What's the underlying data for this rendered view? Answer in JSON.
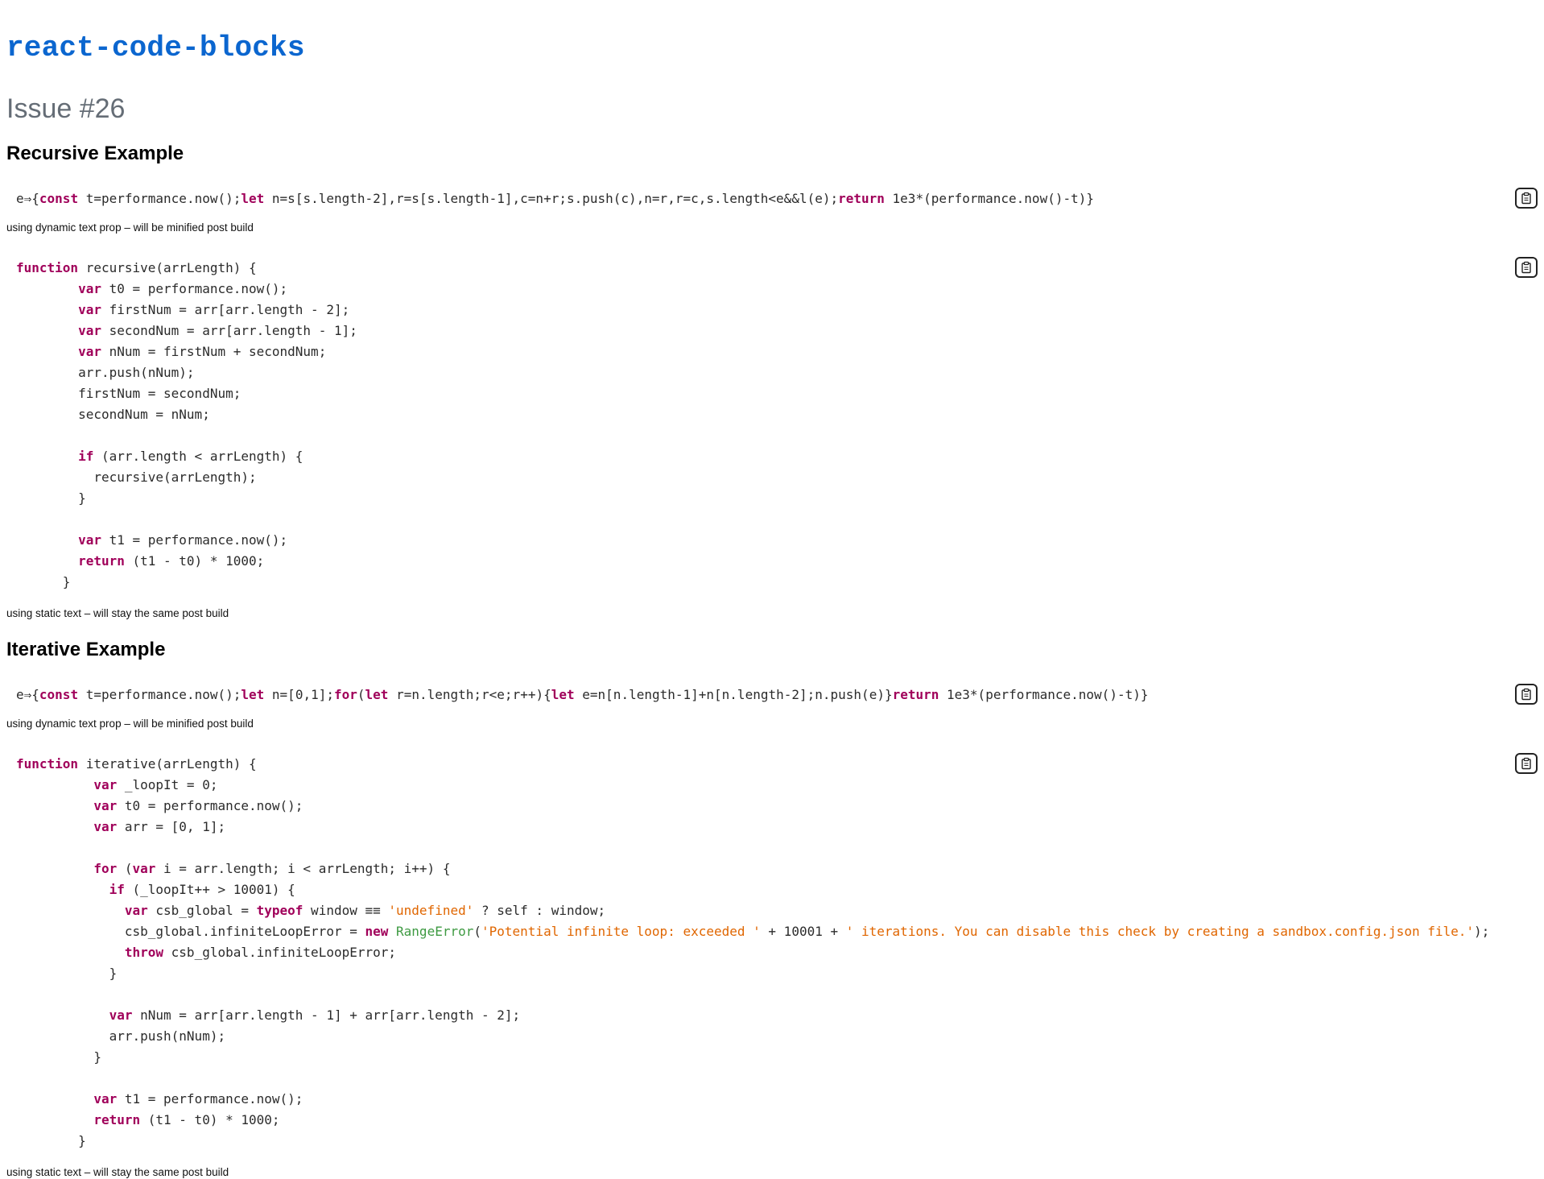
{
  "header": {
    "title": "react-code-blocks",
    "issue": "Issue #26"
  },
  "icons": {
    "copy": "clipboard-icon"
  },
  "sections": {
    "recursive": {
      "title": "Recursive Example",
      "dynamic_caption": "using dynamic text prop – will be minified post build",
      "static_caption": "using static text – will stay the same post build"
    },
    "iterative": {
      "title": "Iterative Example",
      "dynamic_caption": "using dynamic text prop – will be minified post build",
      "static_caption": "using static text – will stay the same post build"
    }
  },
  "code_blocks": {
    "recursive_minified": [
      [
        [
          "p",
          "e⇒{"
        ],
        [
          "k",
          "const"
        ],
        [
          "p",
          " t=performance.now();"
        ],
        [
          "k",
          "let"
        ],
        [
          "p",
          " n=s[s.length-2],r=s[s.length-1],c=n+r;s.push(c),n=r,r=c,s.length<e&&l(e);"
        ],
        [
          "k",
          "return"
        ],
        [
          "p",
          " 1e3*(performance.now()-t)}"
        ]
      ]
    ],
    "recursive_static": [
      [
        [
          "k",
          "function"
        ],
        [
          "p",
          " recursive(arrLength) {"
        ]
      ],
      [
        [
          "p",
          "        "
        ],
        [
          "k",
          "var"
        ],
        [
          "p",
          " t0 = performance.now();"
        ]
      ],
      [
        [
          "p",
          "        "
        ],
        [
          "k",
          "var"
        ],
        [
          "p",
          " firstNum = arr[arr.length - 2];"
        ]
      ],
      [
        [
          "p",
          "        "
        ],
        [
          "k",
          "var"
        ],
        [
          "p",
          " secondNum = arr[arr.length - 1];"
        ]
      ],
      [
        [
          "p",
          "        "
        ],
        [
          "k",
          "var"
        ],
        [
          "p",
          " nNum = firstNum + secondNum;"
        ]
      ],
      [
        [
          "p",
          "        arr.push(nNum);"
        ]
      ],
      [
        [
          "p",
          "        firstNum = secondNum;"
        ]
      ],
      [
        [
          "p",
          "        secondNum = nNum;"
        ]
      ],
      [
        [
          "p",
          ""
        ]
      ],
      [
        [
          "p",
          "        "
        ],
        [
          "k",
          "if"
        ],
        [
          "p",
          " (arr.length < arrLength) {"
        ]
      ],
      [
        [
          "p",
          "          recursive(arrLength);"
        ]
      ],
      [
        [
          "p",
          "        }"
        ]
      ],
      [
        [
          "p",
          ""
        ]
      ],
      [
        [
          "p",
          "        "
        ],
        [
          "k",
          "var"
        ],
        [
          "p",
          " t1 = performance.now();"
        ]
      ],
      [
        [
          "p",
          "        "
        ],
        [
          "k",
          "return"
        ],
        [
          "p",
          " (t1 - t0) * 1000;"
        ]
      ],
      [
        [
          "p",
          "      }"
        ]
      ]
    ],
    "iterative_minified": [
      [
        [
          "p",
          "e⇒{"
        ],
        [
          "k",
          "const"
        ],
        [
          "p",
          " t=performance.now();"
        ],
        [
          "k",
          "let"
        ],
        [
          "p",
          " n=[0,1];"
        ],
        [
          "k",
          "for"
        ],
        [
          "p",
          "("
        ],
        [
          "k",
          "let"
        ],
        [
          "p",
          " r=n.length;r<e;r++){"
        ],
        [
          "k",
          "let"
        ],
        [
          "p",
          " e=n[n.length-1]+n[n.length-2];n.push(e)}"
        ],
        [
          "k",
          "return"
        ],
        [
          "p",
          " 1e3*(performance.now()-t)}"
        ]
      ]
    ],
    "iterative_static": [
      [
        [
          "k",
          "function"
        ],
        [
          "p",
          " iterative(arrLength) {"
        ]
      ],
      [
        [
          "p",
          "          "
        ],
        [
          "k",
          "var"
        ],
        [
          "p",
          " _loopIt = 0;"
        ]
      ],
      [
        [
          "p",
          "          "
        ],
        [
          "k",
          "var"
        ],
        [
          "p",
          " t0 = performance.now();"
        ]
      ],
      [
        [
          "p",
          "          "
        ],
        [
          "k",
          "var"
        ],
        [
          "p",
          " arr = [0, 1];"
        ]
      ],
      [
        [
          "p",
          ""
        ]
      ],
      [
        [
          "p",
          "          "
        ],
        [
          "k",
          "for"
        ],
        [
          "p",
          " ("
        ],
        [
          "k",
          "var"
        ],
        [
          "p",
          " i = arr.length; i < arrLength; i++) {"
        ]
      ],
      [
        [
          "p",
          "            "
        ],
        [
          "k",
          "if"
        ],
        [
          "p",
          " (_loopIt++ > 10001) {"
        ]
      ],
      [
        [
          "p",
          "              "
        ],
        [
          "k",
          "var"
        ],
        [
          "p",
          " csb_global = "
        ],
        [
          "k",
          "typeof"
        ],
        [
          "p",
          " window ≡≡ "
        ],
        [
          "s",
          "'undefined'"
        ],
        [
          "p",
          " ? self : window;"
        ]
      ],
      [
        [
          "p",
          "              csb_global.infiniteLoopError = "
        ],
        [
          "k",
          "new"
        ],
        [
          "p",
          " "
        ],
        [
          "c",
          "RangeError"
        ],
        [
          "p",
          "("
        ],
        [
          "s",
          "'Potential infinite loop: exceeded '"
        ],
        [
          "p",
          " + 10001 + "
        ],
        [
          "s",
          "' iterations. You can disable this check by creating a sandbox.config.json file.'"
        ],
        [
          "p",
          ");"
        ]
      ],
      [
        [
          "p",
          "              "
        ],
        [
          "k",
          "throw"
        ],
        [
          "p",
          " csb_global.infiniteLoopError;"
        ]
      ],
      [
        [
          "p",
          "            }"
        ]
      ],
      [
        [
          "p",
          ""
        ]
      ],
      [
        [
          "p",
          "            "
        ],
        [
          "k",
          "var"
        ],
        [
          "p",
          " nNum = arr[arr.length - 1] + arr[arr.length - 2];"
        ]
      ],
      [
        [
          "p",
          "            arr.push(nNum);"
        ]
      ],
      [
        [
          "p",
          "          }"
        ]
      ],
      [
        [
          "p",
          ""
        ]
      ],
      [
        [
          "p",
          "          "
        ],
        [
          "k",
          "var"
        ],
        [
          "p",
          " t1 = performance.now();"
        ]
      ],
      [
        [
          "p",
          "          "
        ],
        [
          "k",
          "return"
        ],
        [
          "p",
          " (t1 - t0) * 1000;"
        ]
      ],
      [
        [
          "p",
          "        }"
        ]
      ]
    ]
  }
}
